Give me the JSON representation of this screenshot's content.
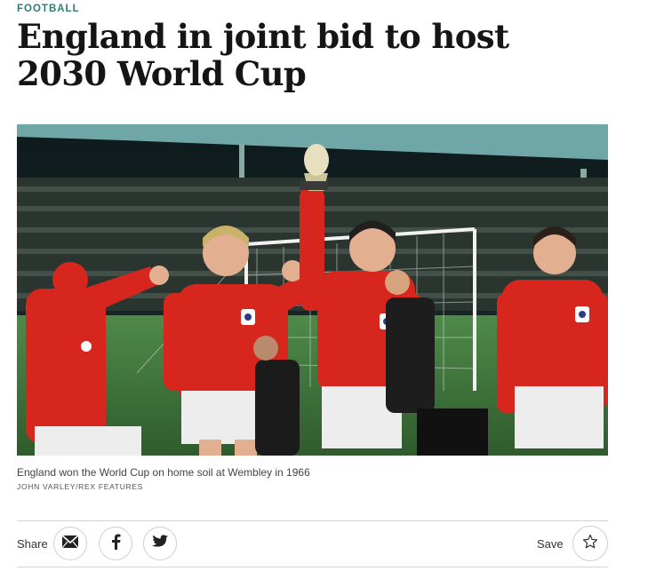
{
  "article": {
    "section": "FOOTBALL",
    "headline": "England in joint bid to host 2030 World Cup",
    "image": {
      "caption": "England won the World Cup on home soil at Wembley in 1966",
      "credit": "JOHN VARLEY/REX FEATURES"
    }
  },
  "share_bar": {
    "share_label": "Share",
    "save_label": "Save",
    "icons": [
      "email-icon",
      "facebook-icon",
      "twitter-icon",
      "star-icon"
    ]
  },
  "colors": {
    "section_accent": "#2e7d6f",
    "shirt_red": "#d7261e",
    "rule": "#d5d5d5"
  }
}
